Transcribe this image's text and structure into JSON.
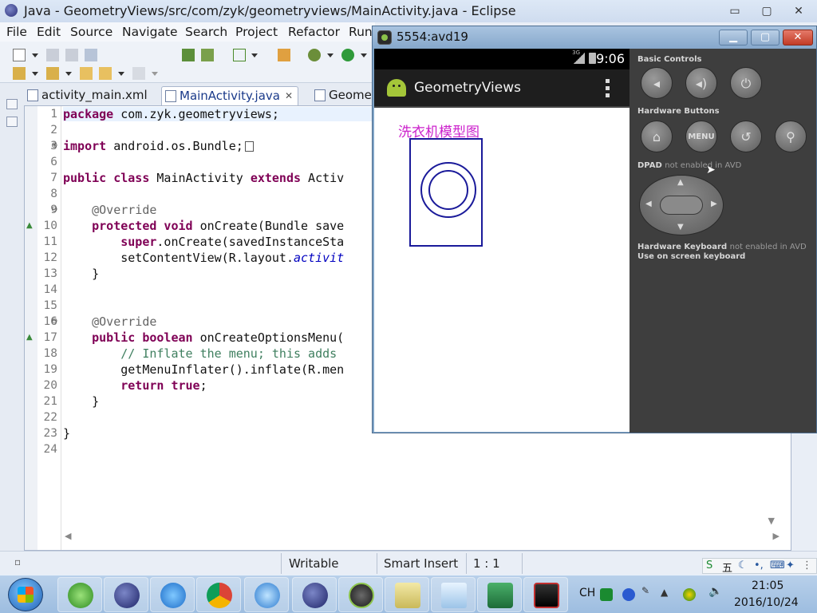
{
  "eclipse": {
    "title": "Java - GeometryViews/src/com/zyk/geometryviews/MainActivity.java - Eclipse",
    "window_buttons": {
      "minimize": "▭",
      "maximize": "▢",
      "close": "✕"
    },
    "menu": [
      "File",
      "Edit",
      "Source",
      "Navigate",
      "Search",
      "Project",
      "Refactor",
      "Run"
    ],
    "tabs": [
      {
        "label": "activity_main.xml",
        "active": false
      },
      {
        "label": "MainActivity.java",
        "active": true
      },
      {
        "label": "Geome",
        "active": false
      }
    ],
    "line_numbers": [
      "1",
      "2",
      "3",
      "6",
      "7",
      "8",
      "9",
      "10",
      "11",
      "12",
      "13",
      "14",
      "15",
      "16",
      "17",
      "18",
      "19",
      "20",
      "21",
      "22",
      "23",
      "24"
    ],
    "code": {
      "l1_kw": "package",
      "l1_rest": " com.zyk.geometryviews;",
      "l3_kw": "import",
      "l3_rest": " android.os.Bundle;",
      "l7_kw1": "public class",
      "l7_mid": " MainActivity ",
      "l7_kw2": "extends",
      "l7_rest": " Activ",
      "l9": "@Override",
      "l10_kw": "protected void",
      "l10_rest": " onCreate(Bundle save",
      "l11_kw": "super",
      "l11_rest": ".onCreate(savedInstanceSta",
      "l12_rest": "setContentView(R.layout.",
      "l12_it": "activit",
      "l13": "}",
      "l16": "@Override",
      "l17_kw": "public boolean",
      "l17_rest": " onCreateOptionsMenu(",
      "l18": "// Inflate the menu; this adds",
      "l19": "getMenuInflater().inflate(R.men",
      "l20_kw": "return true",
      "l20_rest": ";",
      "l21": "}",
      "l23": "}"
    },
    "status": {
      "writable": "Writable",
      "insert_mode": "Smart Insert",
      "position": "1 : 1"
    }
  },
  "emulator": {
    "title": "5554:avd19",
    "phone": {
      "clock": "9:06",
      "network": "3G",
      "app_title": "GeometryViews",
      "canvas_label": "洗衣机模型图"
    },
    "controls": {
      "basic_controls": "Basic Controls",
      "hardware_buttons": "Hardware Buttons",
      "menu_button": "MENU",
      "dpad_title": "DPAD",
      "dpad_note": "not enabled in AVD",
      "keyboard_title": "Hardware Keyboard",
      "keyboard_note": "not enabled in AVD",
      "keyboard_hint": "Use on screen keyboard"
    }
  },
  "taskbar": {
    "lang": "CH",
    "time": "21:05",
    "date": "2016/10/24",
    "ime_label": "五"
  }
}
